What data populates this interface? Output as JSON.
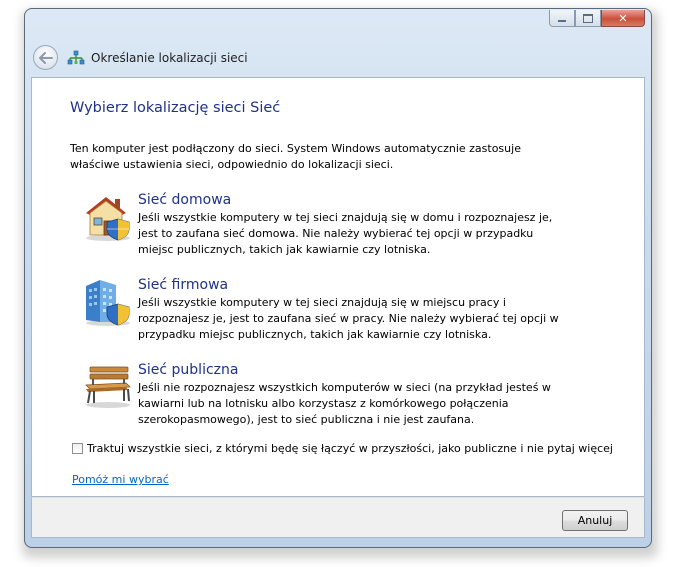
{
  "window": {
    "nav_title": "Określanie lokalizacji sieci",
    "controls": {
      "close_glyph": "✕"
    }
  },
  "content": {
    "heading": "Wybierz lokalizację sieci Sieć",
    "intro": "Ten komputer jest podłączony do sieci. System Windows automatycznie zastosuje właściwe ustawienia sieci, odpowiednio do lokalizacji sieci.",
    "options": [
      {
        "icon": "house-icon",
        "title": "Sieć domowa",
        "description": "Jeśli wszystkie komputery w tej sieci znajdują się w domu i rozpoznajesz je, jest to zaufana sieć domowa. Nie należy wybierać tej opcji w przypadku miejsc publicznych, takich jak kawiarnie czy lotniska."
      },
      {
        "icon": "office-building-icon",
        "title": "Sieć firmowa",
        "description": "Jeśli wszystkie komputery w tej sieci znajdują się w miejscu pracy i rozpoznajesz je, jest to zaufana sieć w pracy. Nie należy wybierać tej opcji w przypadku miejsc publicznych, takich jak kawiarnie czy lotniska."
      },
      {
        "icon": "park-bench-icon",
        "title": "Sieć publiczna",
        "description": "Jeśli nie rozpoznajesz wszystkich komputerów w sieci (na przykład jesteś w kawiarni lub na lotnisku albo korzystasz z komórkowego połączenia szerokopasmowego), jest to sieć publiczna i nie jest zaufana."
      }
    ],
    "checkbox_label": "Traktuj wszystkie sieci, z którymi będę się łączyć w przyszłości, jako publiczne i nie pytaj więcej",
    "checkbox_checked": false,
    "help_link": "Pomóż mi wybrać"
  },
  "footer": {
    "cancel_label": "Anuluj"
  },
  "colors": {
    "heading": "#1e3287",
    "link": "#0066cc",
    "close_button": "#c9503c"
  }
}
